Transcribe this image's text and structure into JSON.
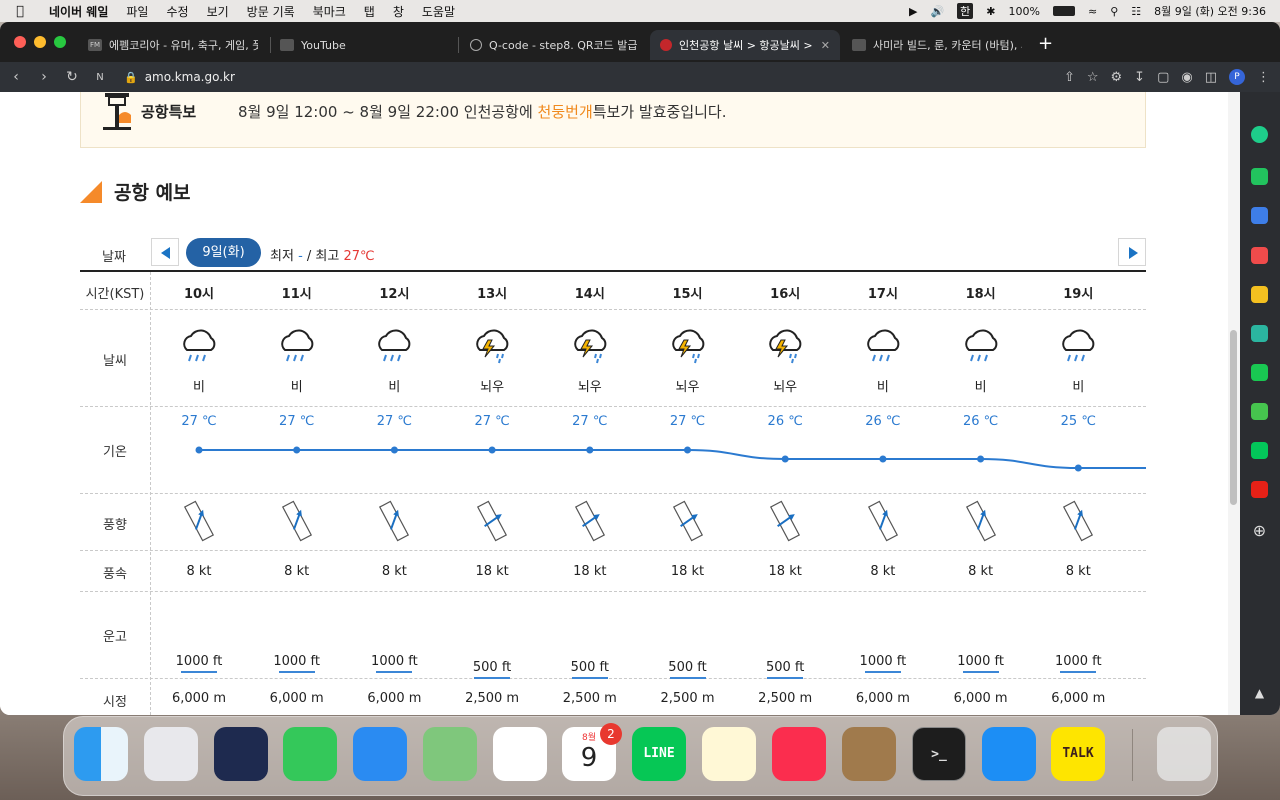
{
  "menubar": {
    "app": "네이버 웨일",
    "items": [
      "파일",
      "수정",
      "보기",
      "방문 기록",
      "북마크",
      "탭",
      "창",
      "도움말"
    ],
    "battery": "100%",
    "clock": "8월 9일 (화) 오전 9:36",
    "ime": "한"
  },
  "tabs": [
    {
      "label": "에펨코리아 - 유머, 축구, 게임, 풋볼매",
      "favicon": "FM"
    },
    {
      "label": "YouTube"
    },
    {
      "label": "Q-code - step8. QR코드 발급"
    },
    {
      "label": "인천공항 날씨 > 항공날씨 > 항공기상"
    },
    {
      "label": "사미라 빌드, 룬, 카운터 (바텀), 시즌"
    }
  ],
  "url": "amo.kma.go.kr",
  "notice": {
    "label": "공항특보",
    "text_before": "8월 9일 12:00 ~ 8월 9일 22:00 인천공항에 ",
    "highlight": "천둥번개",
    "text_after": "특보가 발효중입니다."
  },
  "section_title": "공항 예보",
  "datebar": {
    "label": "날짜",
    "date": "9일(화)",
    "min_label": "최저",
    "min_value": "-",
    "max_label": "/ 최고",
    "max_value": "27℃"
  },
  "rows": {
    "time": "시간(KST)",
    "weather": "날씨",
    "temp": "기온",
    "wind_dir": "풍향",
    "wind_speed": "풍속",
    "ceiling": "운고",
    "visibility": "시정"
  },
  "forecast": [
    {
      "hour": "10시",
      "weather": "비",
      "icon": "rain-cloud-icon",
      "temp": "27 ℃",
      "temp_value": 27,
      "wind_dir_deg": 20,
      "wind": "8 kt",
      "ceiling": "1000 ft",
      "ceiling_value": 1000,
      "vis": "6,000 m"
    },
    {
      "hour": "11시",
      "weather": "비",
      "icon": "rain-cloud-icon",
      "temp": "27 ℃",
      "temp_value": 27,
      "wind_dir_deg": 20,
      "wind": "8 kt",
      "ceiling": "1000 ft",
      "ceiling_value": 1000,
      "vis": "6,000 m"
    },
    {
      "hour": "12시",
      "weather": "비",
      "icon": "rain-cloud-icon",
      "temp": "27 ℃",
      "temp_value": 27,
      "wind_dir_deg": 20,
      "wind": "8 kt",
      "ceiling": "1000 ft",
      "ceiling_value": 1000,
      "vis": "6,000 m"
    },
    {
      "hour": "13시",
      "weather": "뇌우",
      "icon": "thunderstorm-icon",
      "temp": "27 ℃",
      "temp_value": 27,
      "wind_dir_deg": 55,
      "wind": "18 kt",
      "ceiling": "500 ft",
      "ceiling_value": 500,
      "vis": "2,500 m"
    },
    {
      "hour": "14시",
      "weather": "뇌우",
      "icon": "thunderstorm-icon",
      "temp": "27 ℃",
      "temp_value": 27,
      "wind_dir_deg": 55,
      "wind": "18 kt",
      "ceiling": "500 ft",
      "ceiling_value": 500,
      "vis": "2,500 m"
    },
    {
      "hour": "15시",
      "weather": "뇌우",
      "icon": "thunderstorm-icon",
      "temp": "27 ℃",
      "temp_value": 27,
      "wind_dir_deg": 55,
      "wind": "18 kt",
      "ceiling": "500 ft",
      "ceiling_value": 500,
      "vis": "2,500 m"
    },
    {
      "hour": "16시",
      "weather": "뇌우",
      "icon": "thunderstorm-icon",
      "temp": "26 ℃",
      "temp_value": 26,
      "wind_dir_deg": 55,
      "wind": "18 kt",
      "ceiling": "500 ft",
      "ceiling_value": 500,
      "vis": "2,500 m"
    },
    {
      "hour": "17시",
      "weather": "비",
      "icon": "rain-cloud-icon",
      "temp": "26 ℃",
      "temp_value": 26,
      "wind_dir_deg": 20,
      "wind": "8 kt",
      "ceiling": "1000 ft",
      "ceiling_value": 1000,
      "vis": "6,000 m"
    },
    {
      "hour": "18시",
      "weather": "비",
      "icon": "rain-cloud-icon",
      "temp": "26 ℃",
      "temp_value": 26,
      "wind_dir_deg": 20,
      "wind": "8 kt",
      "ceiling": "1000 ft",
      "ceiling_value": 1000,
      "vis": "6,000 m"
    },
    {
      "hour": "19시",
      "weather": "비",
      "icon": "rain-cloud-icon",
      "temp": "25 ℃",
      "temp_value": 25,
      "wind_dir_deg": 20,
      "wind": "8 kt",
      "ceiling": "1000 ft",
      "ceiling_value": 1000,
      "vis": "6,000 m"
    }
  ],
  "colors": {
    "accent_blue": "#2462a5",
    "temp_blue": "#2b7ad0",
    "warning_orange": "#f08a1f",
    "max_red": "#e53935"
  },
  "dock": {
    "apps": [
      "finder-icon",
      "launchpad-icon",
      "whale-browser-icon",
      "messages-icon",
      "mail-icon",
      "maps-icon",
      "photos-icon",
      "calendar-icon",
      "line-icon",
      "notes-icon",
      "music-icon",
      "contacts-icon",
      "terminal-icon",
      "app-store-icon",
      "kakaotalk-icon",
      "trash-icon"
    ],
    "calendar_month": "8월",
    "calendar_day": "9",
    "calendar_badge": "2",
    "line_label": "LINE",
    "kakao_label": "TALK",
    "terminal_prompt": ">_"
  }
}
